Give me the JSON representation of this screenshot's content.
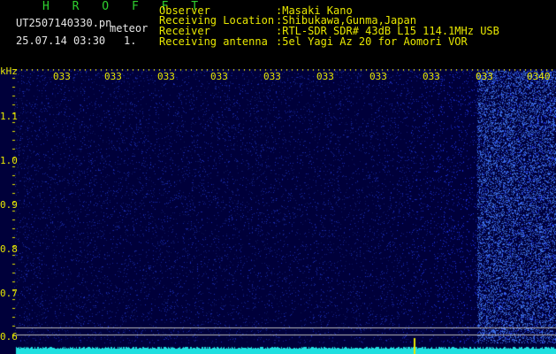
{
  "header": {
    "app_name": "H R O F F T",
    "file_name": "UT2507140330.pn",
    "mode": "meteor",
    "datetime": "25.07.14 03:30",
    "count": "1.",
    "observer_label": "Observer",
    "observer_value": ":Masaki Kano",
    "location_label": "Receiving Location",
    "location_value": ":Shibukawa,Gunma,Japan",
    "receiver_label": "Receiver",
    "receiver_value": ":RTL-SDR SDR# 43dB L15 114.1MHz USB",
    "antenna_label": "Receiving antenna",
    "antenna_value": ":5el Yagi Az 20 for Aomori VOR"
  },
  "spectrogram": {
    "y_unit": "kHz",
    "time_ticks": [
      "033",
      "033",
      "033",
      "033",
      "033",
      "033",
      "033",
      "033",
      "033",
      "0340"
    ],
    "freq_ticks": [
      "1.1",
      "1.0",
      "0.9",
      "0.8",
      "0.7",
      "0.6"
    ],
    "colors": {
      "background": "#000000",
      "noise": "#1a2fd0",
      "text": "#e8e800",
      "baseline": "#20e0e0"
    }
  }
}
